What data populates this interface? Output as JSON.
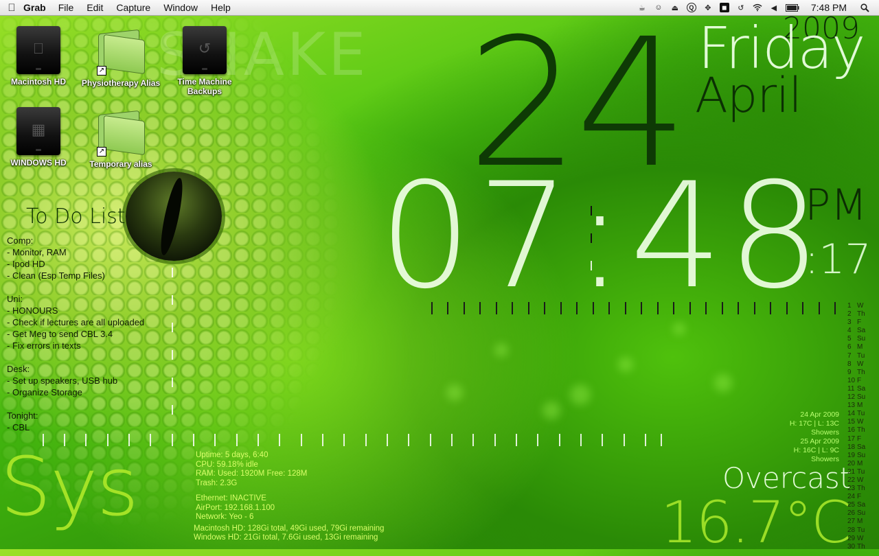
{
  "menubar": {
    "app": "Grab",
    "menus": [
      "File",
      "Edit",
      "Capture",
      "Window",
      "Help"
    ],
    "clock": "7:48 PM",
    "status_icons": [
      "coffee-icon",
      "user-icon",
      "eject-icon",
      "q-icon",
      "crosshair-icon",
      "app-icon",
      "time-machine-icon",
      "wifi-icon",
      "volume-icon",
      "battery-icon",
      "spotlight-icon"
    ]
  },
  "desktop": {
    "icons": [
      {
        "label": "Macintosh HD",
        "type": "drive"
      },
      {
        "label": "Physiotherapy Alias",
        "type": "folder"
      },
      {
        "label": "Time Machine Backups",
        "type": "drive"
      },
      {
        "label": "WINDOWS HD",
        "type": "drive"
      },
      {
        "label": "Temporary alias",
        "type": "folder"
      }
    ],
    "watermark": "SNAKE"
  },
  "clock_widget": {
    "day_number": "24",
    "year": "2009",
    "weekday": "Friday",
    "month": "April",
    "time": "07:48",
    "ampm": "PM",
    "seconds": ":17"
  },
  "todo": {
    "title": "To Do List",
    "sections": [
      {
        "heading": "Comp:",
        "items": [
          "- Monitor, RAM",
          "- Ipod HD",
          "- Clean (Esp Temp Files)"
        ]
      },
      {
        "heading": "Uni:",
        "items": [
          "- HONOURS",
          "- Check if lectures are all uploaded",
          "- Get Meg to send CBL 3.4",
          "- Fix errors in texts"
        ]
      },
      {
        "heading": "Desk:",
        "items": [
          "- Set up speakers, USB hub",
          "- Organize Storage"
        ]
      },
      {
        "heading": "Tonight:",
        "items": [
          "- CBL"
        ]
      }
    ]
  },
  "sys": {
    "word": "Sys",
    "uptime": "Uptime: 5 days, 6:40",
    "cpu": "CPU:  59.18% idle",
    "ram": "RAM:  Used: 1920M Free: 128M",
    "trash": "Trash: 2.3G",
    "ethernet": "Ethernet: INACTIVE",
    "airport": "AirPort: 192.168.1.100",
    "network": "Network: Yeo - 6",
    "mac_hd": "Macintosh HD: 128Gi total, 49Gi used, 79Gi remaining",
    "win_hd": "Windows HD: 21Gi total, 7.6Gi used, 13Gi remaining"
  },
  "weather": {
    "forecast": [
      {
        "date": "24 Apr 2009",
        "range": "H: 17C | L: 13C",
        "cond": "Showers"
      },
      {
        "date": "25 Apr 2009",
        "range": "H: 16C | L: 9C",
        "cond": "Showers"
      }
    ],
    "condition": "Overcast",
    "temperature": "16.7°C"
  },
  "calendar": [
    [
      "1",
      "W"
    ],
    [
      "2",
      "Th"
    ],
    [
      "3",
      "F"
    ],
    [
      "4",
      "Sa"
    ],
    [
      "5",
      "Su"
    ],
    [
      "6",
      "M"
    ],
    [
      "7",
      "Tu"
    ],
    [
      "8",
      "W"
    ],
    [
      "9",
      "Th"
    ],
    [
      "10",
      "F"
    ],
    [
      "11",
      "Sa"
    ],
    [
      "12",
      "Su"
    ],
    [
      "13",
      "M"
    ],
    [
      "14",
      "Tu"
    ],
    [
      "15",
      "W"
    ],
    [
      "16",
      "Th"
    ],
    [
      "17",
      "F"
    ],
    [
      "18",
      "Sa"
    ],
    [
      "19",
      "Su"
    ],
    [
      "20",
      "M"
    ],
    [
      "21",
      "Tu"
    ],
    [
      "22",
      "W"
    ],
    [
      "23",
      "Th"
    ],
    [
      "24",
      "F"
    ],
    [
      "25",
      "Sa"
    ],
    [
      "26",
      "Su"
    ],
    [
      "27",
      "M"
    ],
    [
      "28",
      "Tu"
    ],
    [
      "29",
      "W"
    ],
    [
      "30",
      "Th"
    ]
  ]
}
